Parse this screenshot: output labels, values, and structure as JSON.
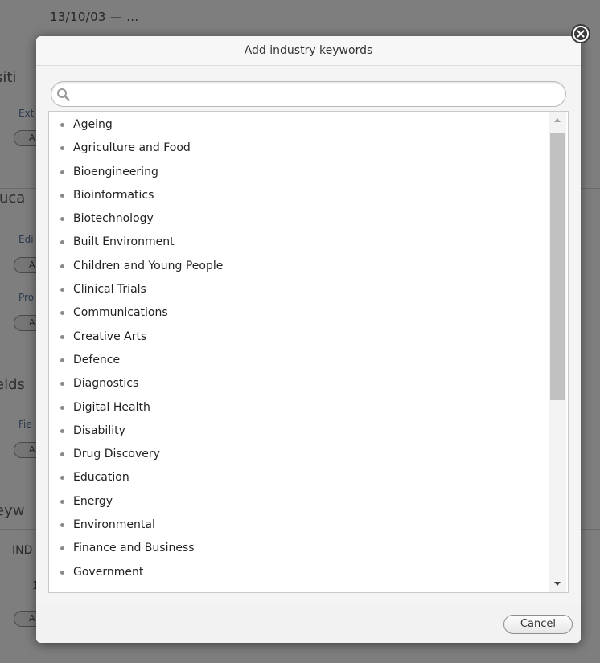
{
  "background": {
    "date_text": "13/10/03 — ...",
    "headings": [
      "siti",
      "luca",
      "elds",
      "eyw"
    ],
    "subs": [
      "Ext",
      "Edi",
      "Pro",
      "Fie"
    ],
    "pill_text": "A",
    "industry_col": "IND",
    "number_text": "1"
  },
  "dialog": {
    "title": "Add industry keywords",
    "search": {
      "value": "",
      "placeholder": ""
    },
    "items": [
      "Ageing",
      "Agriculture and Food",
      "Bioengineering",
      "Bioinformatics",
      "Biotechnology",
      "Built Environment",
      "Children and Young People",
      "Clinical Trials",
      "Communications",
      "Creative Arts",
      "Defence",
      "Diagnostics",
      "Digital Health",
      "Disability",
      "Drug Discovery",
      "Education",
      "Energy",
      "Environmental",
      "Finance and Business",
      "Government"
    ],
    "cancel_label": "Cancel"
  },
  "icons": {
    "search": "search-icon",
    "close": "close-icon",
    "scroll_up": "chevron-up-icon",
    "scroll_down": "chevron-down-icon"
  },
  "colors": {
    "overlay": "#7e7e7e",
    "modal_bg": "#f4f4f4",
    "bullet": "#8a8a8a",
    "scroll_thumb": "#c1c1c1"
  }
}
